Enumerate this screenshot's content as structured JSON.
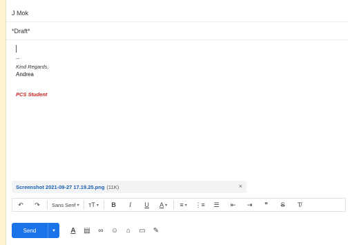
{
  "compose": {
    "to": "J Mok",
    "subject": "*Draft*",
    "body": {
      "dash": "--",
      "regards": "Kind Regards,",
      "name": "Andrea",
      "signature": "PCS Student"
    }
  },
  "attachment": {
    "filename": "Screenshot 2021-09-27 17.19.25.png",
    "size": "(11K)",
    "close": "×"
  },
  "toolbar": {
    "undo": "↶",
    "redo": "↷",
    "font": "Sans Serif",
    "font_caret": "▾",
    "size": "тT",
    "size_caret": "▾",
    "bold": "B",
    "italic": "I",
    "underline": "U",
    "text_color": "A",
    "text_color_caret": "▾",
    "align": "≡",
    "align_caret": "▾",
    "numbered_list": "⋮≡",
    "bulleted_list": "☰",
    "indent_less": "⇤",
    "indent_more": "⇥",
    "quote": "❞",
    "strikethrough": "S",
    "clear_format": "T̸"
  },
  "bottom": {
    "send": "Send",
    "send_caret": "▾",
    "icons": {
      "formatting": "A",
      "attach": "▤",
      "link": "∞",
      "emoji": "☺",
      "drive": "⌂",
      "photo": "▭",
      "signature": "✎"
    }
  }
}
